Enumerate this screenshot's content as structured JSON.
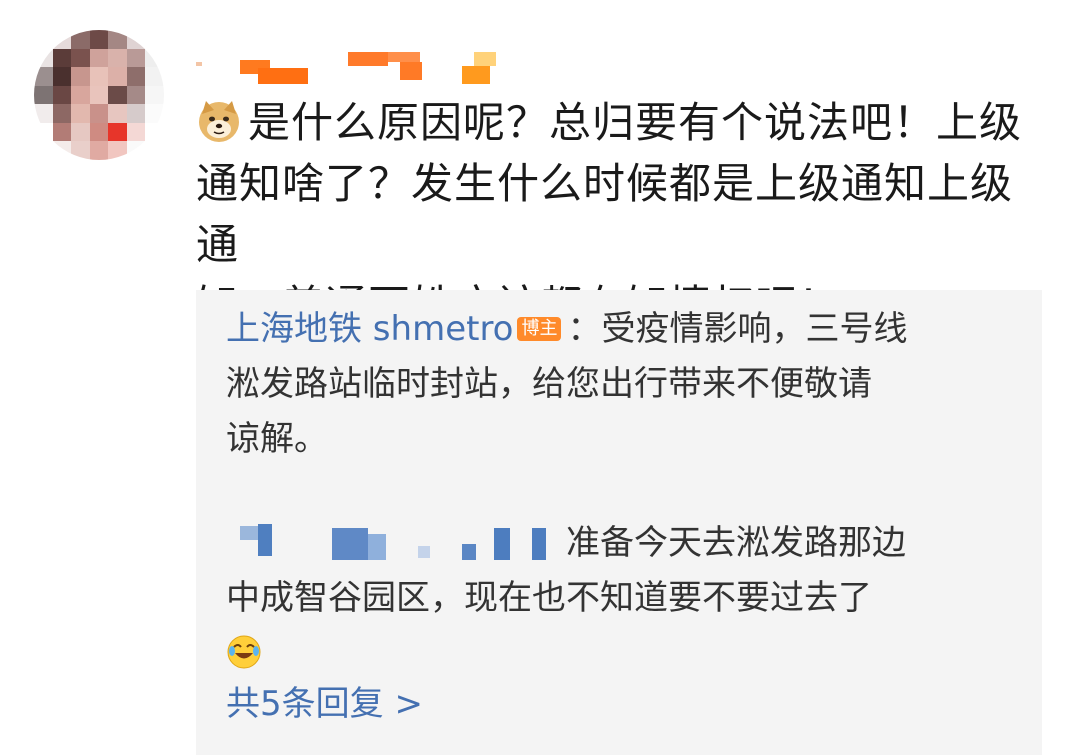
{
  "comment": {
    "text_line1": "是什么原因呢？总归要有个说法吧！上级",
    "text_line2": "通知啥了？发生什么时候都是上级通知上级通",
    "text_line3": "知，普通百姓应该都有知情权吧！",
    "emoji_icon": "doge-icon"
  },
  "reply_1": {
    "author": "上海地铁 shmetro",
    "badge": "博主",
    "separator": "：",
    "text_line1": "受疫情影响，三号线",
    "text_line2": "淞发路站临时封站，给您出行带来不便敬请",
    "text_line3": "谅解。"
  },
  "reply_2": {
    "text_line1": "准备今天去淞发路那边",
    "text_line2": "中成智谷园区，现在也不知道要不要过去了",
    "emoji_icon": "laugh-cry-icon"
  },
  "more_replies": {
    "label": "共5条回复 >"
  },
  "colors": {
    "link": "#4470b1",
    "badge": "#ff8a2a",
    "reply_bg": "#f4f4f4"
  }
}
